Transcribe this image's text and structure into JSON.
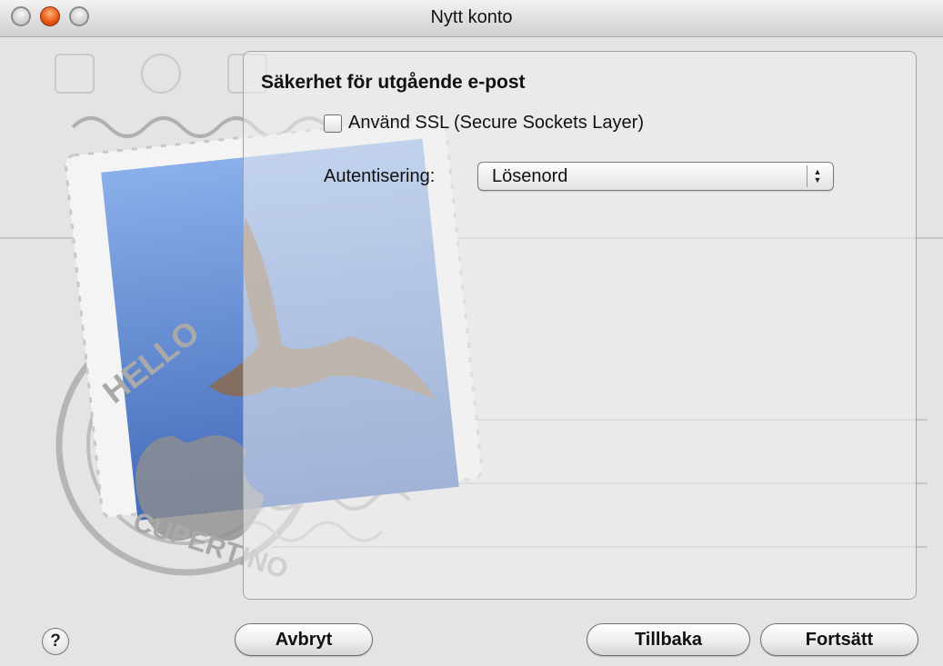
{
  "window": {
    "title": "Nytt konto"
  },
  "section": {
    "title": "Säkerhet för utgående e-post",
    "ssl_checkbox": {
      "label": "Använd SSL (Secure Sockets Layer)",
      "checked": false
    },
    "authentication": {
      "label": "Autentisering:",
      "selected": "Lösenord"
    }
  },
  "buttons": {
    "help": "?",
    "cancel": "Avbryt",
    "back": "Tillbaka",
    "continue": "Fortsätt"
  },
  "colors": {
    "min_button": "#e8530f",
    "stamp_blue": "#4a78c8",
    "sky_blue": "#9ec0ea"
  }
}
